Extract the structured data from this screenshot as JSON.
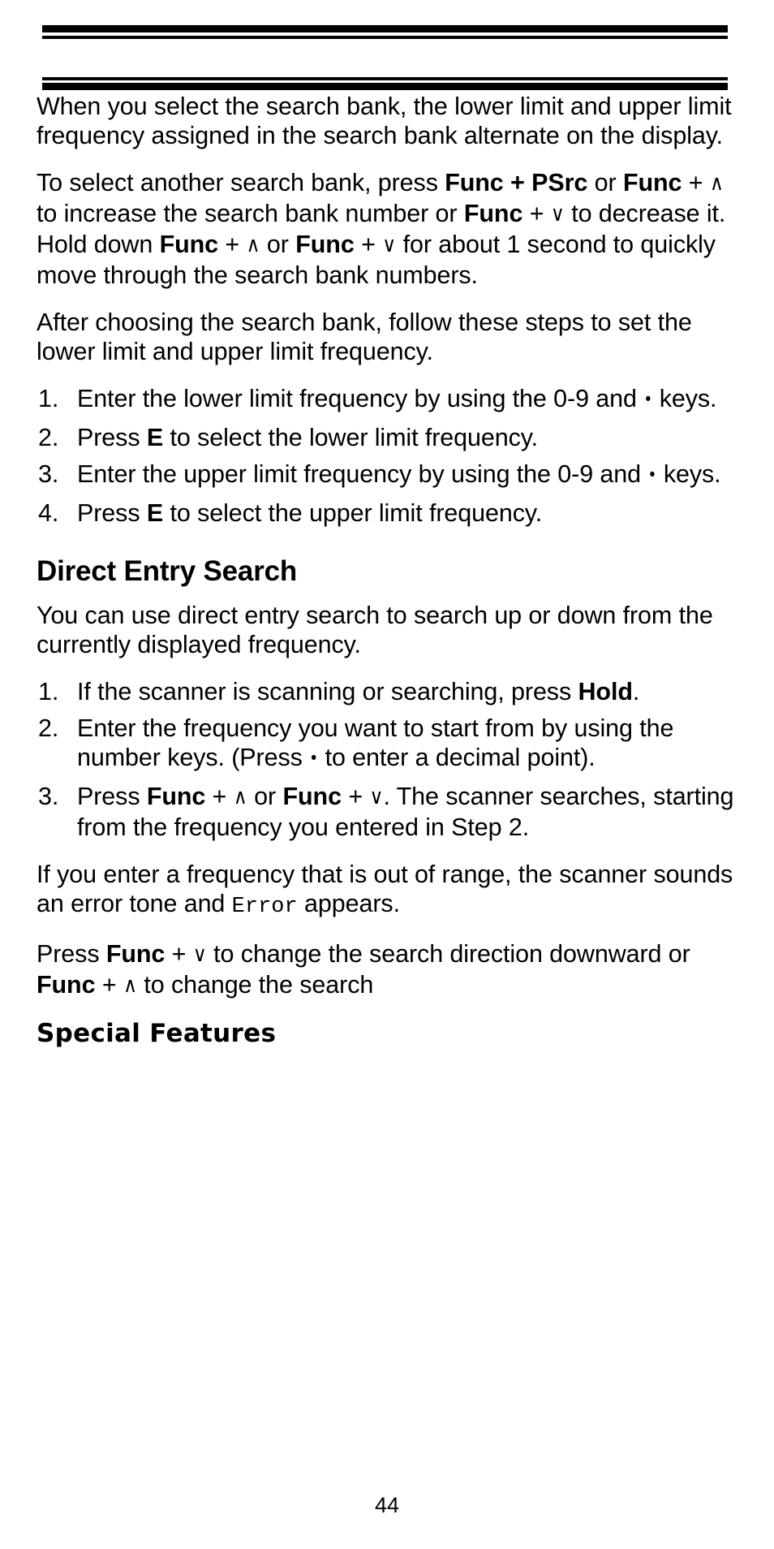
{
  "document": {
    "page_number": "44",
    "header_rules": [
      "thick",
      "thin",
      "thin",
      "thick"
    ]
  },
  "body": {
    "paragraph_1": {
      "text": "When you select the search bank, the lower limit and upper limit frequency assigned in the search bank alternate on the display."
    },
    "paragraph_2": {
      "part_1": "To select another search bank, press ",
      "bold_func_1": "Func",
      "plus_1": " + ",
      "bold_psrc": "PSrc",
      "part_2": " or ",
      "bold_func_2": "Func",
      "plus_2": " + ",
      "chevron_up_1": "∧",
      "part_3": "  to increase the search bank number or ",
      "bold_func_3": "Func",
      "plus_3": " + ",
      "chevron_down_1": "∨",
      "part_4": " to decrease it. Hold down ",
      "bold_func_4": "Func",
      "plus_4": " + ",
      "chevron_up_2": "∧",
      "part_5": " or ",
      "bold_func_5": "Func",
      "plus_5": " + ",
      "chevron_down_2": "∨",
      "part_6": " for about 1 second to quickly move through the search bank numbers."
    },
    "paragraph_3": {
      "text": "After choosing the search bank, follow these steps to set the lower limit and upper limit frequency."
    },
    "steps_limits": [
      {
        "number": "1.",
        "part_1": "Enter the lower limit frequency by using the 0-9 and ",
        "dot": "•",
        "part_2": "  keys."
      },
      {
        "number": "2.",
        "part_1": "Press ",
        "bold": "E",
        "part_2": " to select the lower limit frequency."
      },
      {
        "number": "3.",
        "part_1": "Enter the upper limit frequency by using the 0-9 and ",
        "dot": "•",
        "part_2": " keys."
      },
      {
        "number": "4.",
        "part_1": "Press ",
        "bold": "E",
        "part_2": " to select the upper limit frequency."
      }
    ],
    "heading_direct_entry": "Direct Entry Search",
    "paragraph_4": {
      "text": "You can use direct entry search to search up or down from the currently displayed frequency."
    },
    "steps_direct_entry": [
      {
        "number": "1.",
        "part_1": "If the scanner is scanning or searching, press ",
        "bold": "Hold",
        "part_2": "."
      },
      {
        "number": "2.",
        "part_1": "Enter the frequency you want to start from by using the number keys. (Press ",
        "dot": "•",
        "part_2": "  to enter a decimal point)."
      },
      {
        "number": "3.",
        "part_1": "Press ",
        "bold_func_1": "Func",
        "plus_1": " + ",
        "chevron_up": "∧",
        "part_2": " or ",
        "bold_func_2": "Func",
        "plus_2": " + ",
        "chevron_down": "∨",
        "part_3": ". The scanner searches, starting from the frequency you entered in Step 2."
      }
    ],
    "paragraph_5": {
      "part_1": "If you enter a frequency that is out of range, the scanner sounds an error tone and ",
      "mono": "Error",
      "part_2": " appears."
    },
    "paragraph_6": {
      "part_1": "Press ",
      "bold_func_1": "Func",
      "plus_1": " + ",
      "chevron_down": "∨",
      "part_2": " to change the search direction downward or ",
      "bold_func_2": "Func",
      "plus_2": " + ",
      "chevron_up": "∧",
      "part_3": " to change the search"
    },
    "heading_special_features": "Special Features"
  }
}
